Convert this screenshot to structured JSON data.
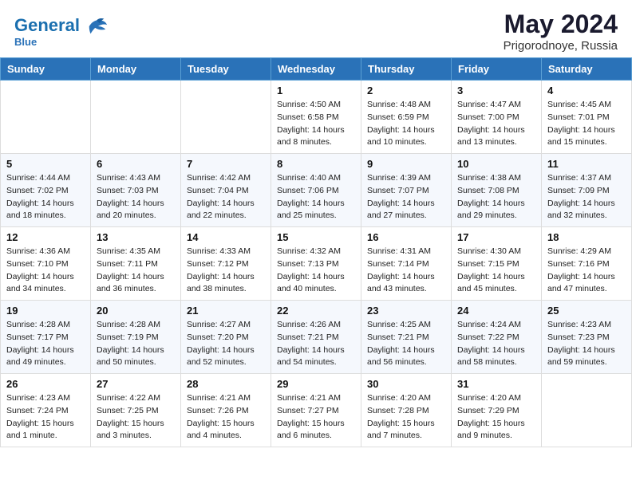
{
  "header": {
    "logo_line1": "General",
    "logo_line2": "Blue",
    "month": "May 2024",
    "location": "Prigorodnoye, Russia"
  },
  "weekdays": [
    "Sunday",
    "Monday",
    "Tuesday",
    "Wednesday",
    "Thursday",
    "Friday",
    "Saturday"
  ],
  "weeks": [
    [
      {
        "day": "",
        "sunrise": "",
        "sunset": "",
        "daylight": ""
      },
      {
        "day": "",
        "sunrise": "",
        "sunset": "",
        "daylight": ""
      },
      {
        "day": "",
        "sunrise": "",
        "sunset": "",
        "daylight": ""
      },
      {
        "day": "1",
        "sunrise": "Sunrise: 4:50 AM",
        "sunset": "Sunset: 6:58 PM",
        "daylight": "Daylight: 14 hours and 8 minutes."
      },
      {
        "day": "2",
        "sunrise": "Sunrise: 4:48 AM",
        "sunset": "Sunset: 6:59 PM",
        "daylight": "Daylight: 14 hours and 10 minutes."
      },
      {
        "day": "3",
        "sunrise": "Sunrise: 4:47 AM",
        "sunset": "Sunset: 7:00 PM",
        "daylight": "Daylight: 14 hours and 13 minutes."
      },
      {
        "day": "4",
        "sunrise": "Sunrise: 4:45 AM",
        "sunset": "Sunset: 7:01 PM",
        "daylight": "Daylight: 14 hours and 15 minutes."
      }
    ],
    [
      {
        "day": "5",
        "sunrise": "Sunrise: 4:44 AM",
        "sunset": "Sunset: 7:02 PM",
        "daylight": "Daylight: 14 hours and 18 minutes."
      },
      {
        "day": "6",
        "sunrise": "Sunrise: 4:43 AM",
        "sunset": "Sunset: 7:03 PM",
        "daylight": "Daylight: 14 hours and 20 minutes."
      },
      {
        "day": "7",
        "sunrise": "Sunrise: 4:42 AM",
        "sunset": "Sunset: 7:04 PM",
        "daylight": "Daylight: 14 hours and 22 minutes."
      },
      {
        "day": "8",
        "sunrise": "Sunrise: 4:40 AM",
        "sunset": "Sunset: 7:06 PM",
        "daylight": "Daylight: 14 hours and 25 minutes."
      },
      {
        "day": "9",
        "sunrise": "Sunrise: 4:39 AM",
        "sunset": "Sunset: 7:07 PM",
        "daylight": "Daylight: 14 hours and 27 minutes."
      },
      {
        "day": "10",
        "sunrise": "Sunrise: 4:38 AM",
        "sunset": "Sunset: 7:08 PM",
        "daylight": "Daylight: 14 hours and 29 minutes."
      },
      {
        "day": "11",
        "sunrise": "Sunrise: 4:37 AM",
        "sunset": "Sunset: 7:09 PM",
        "daylight": "Daylight: 14 hours and 32 minutes."
      }
    ],
    [
      {
        "day": "12",
        "sunrise": "Sunrise: 4:36 AM",
        "sunset": "Sunset: 7:10 PM",
        "daylight": "Daylight: 14 hours and 34 minutes."
      },
      {
        "day": "13",
        "sunrise": "Sunrise: 4:35 AM",
        "sunset": "Sunset: 7:11 PM",
        "daylight": "Daylight: 14 hours and 36 minutes."
      },
      {
        "day": "14",
        "sunrise": "Sunrise: 4:33 AM",
        "sunset": "Sunset: 7:12 PM",
        "daylight": "Daylight: 14 hours and 38 minutes."
      },
      {
        "day": "15",
        "sunrise": "Sunrise: 4:32 AM",
        "sunset": "Sunset: 7:13 PM",
        "daylight": "Daylight: 14 hours and 40 minutes."
      },
      {
        "day": "16",
        "sunrise": "Sunrise: 4:31 AM",
        "sunset": "Sunset: 7:14 PM",
        "daylight": "Daylight: 14 hours and 43 minutes."
      },
      {
        "day": "17",
        "sunrise": "Sunrise: 4:30 AM",
        "sunset": "Sunset: 7:15 PM",
        "daylight": "Daylight: 14 hours and 45 minutes."
      },
      {
        "day": "18",
        "sunrise": "Sunrise: 4:29 AM",
        "sunset": "Sunset: 7:16 PM",
        "daylight": "Daylight: 14 hours and 47 minutes."
      }
    ],
    [
      {
        "day": "19",
        "sunrise": "Sunrise: 4:28 AM",
        "sunset": "Sunset: 7:17 PM",
        "daylight": "Daylight: 14 hours and 49 minutes."
      },
      {
        "day": "20",
        "sunrise": "Sunrise: 4:28 AM",
        "sunset": "Sunset: 7:19 PM",
        "daylight": "Daylight: 14 hours and 50 minutes."
      },
      {
        "day": "21",
        "sunrise": "Sunrise: 4:27 AM",
        "sunset": "Sunset: 7:20 PM",
        "daylight": "Daylight: 14 hours and 52 minutes."
      },
      {
        "day": "22",
        "sunrise": "Sunrise: 4:26 AM",
        "sunset": "Sunset: 7:21 PM",
        "daylight": "Daylight: 14 hours and 54 minutes."
      },
      {
        "day": "23",
        "sunrise": "Sunrise: 4:25 AM",
        "sunset": "Sunset: 7:21 PM",
        "daylight": "Daylight: 14 hours and 56 minutes."
      },
      {
        "day": "24",
        "sunrise": "Sunrise: 4:24 AM",
        "sunset": "Sunset: 7:22 PM",
        "daylight": "Daylight: 14 hours and 58 minutes."
      },
      {
        "day": "25",
        "sunrise": "Sunrise: 4:23 AM",
        "sunset": "Sunset: 7:23 PM",
        "daylight": "Daylight: 14 hours and 59 minutes."
      }
    ],
    [
      {
        "day": "26",
        "sunrise": "Sunrise: 4:23 AM",
        "sunset": "Sunset: 7:24 PM",
        "daylight": "Daylight: 15 hours and 1 minute."
      },
      {
        "day": "27",
        "sunrise": "Sunrise: 4:22 AM",
        "sunset": "Sunset: 7:25 PM",
        "daylight": "Daylight: 15 hours and 3 minutes."
      },
      {
        "day": "28",
        "sunrise": "Sunrise: 4:21 AM",
        "sunset": "Sunset: 7:26 PM",
        "daylight": "Daylight: 15 hours and 4 minutes."
      },
      {
        "day": "29",
        "sunrise": "Sunrise: 4:21 AM",
        "sunset": "Sunset: 7:27 PM",
        "daylight": "Daylight: 15 hours and 6 minutes."
      },
      {
        "day": "30",
        "sunrise": "Sunrise: 4:20 AM",
        "sunset": "Sunset: 7:28 PM",
        "daylight": "Daylight: 15 hours and 7 minutes."
      },
      {
        "day": "31",
        "sunrise": "Sunrise: 4:20 AM",
        "sunset": "Sunset: 7:29 PM",
        "daylight": "Daylight: 15 hours and 9 minutes."
      },
      {
        "day": "",
        "sunrise": "",
        "sunset": "",
        "daylight": ""
      }
    ]
  ]
}
